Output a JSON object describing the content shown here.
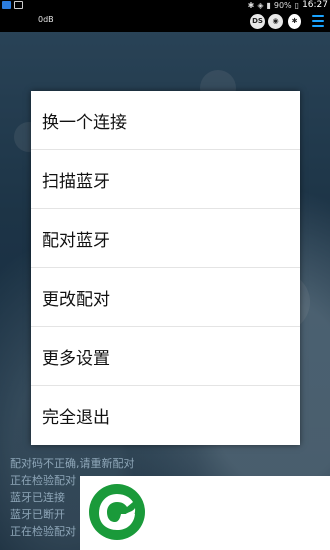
{
  "status_bar": {
    "battery": "90%",
    "time": "16:27",
    "icons": [
      "app-icon",
      "image-icon",
      "bluetooth-icon",
      "wifi-icon",
      "signal-icon",
      "battery-icon"
    ]
  },
  "app_bar": {
    "level": "0dB",
    "icons": [
      "ds-badge-icon",
      "lock-badge-icon",
      "bluetooth-icon",
      "menu-icon"
    ],
    "accent": "#1aa3ff"
  },
  "menu": {
    "items": [
      "换一个连接",
      "扫描蓝牙",
      "配对蓝牙",
      "更改配对",
      "更多设置",
      "完全退出"
    ]
  },
  "log": [
    "配对码不正确,请重新配对",
    "正在检验配对",
    "蓝牙已连接",
    "蓝牙已断开",
    "正在检验配对"
  ],
  "logo": {
    "color": "#1a9a3a"
  }
}
